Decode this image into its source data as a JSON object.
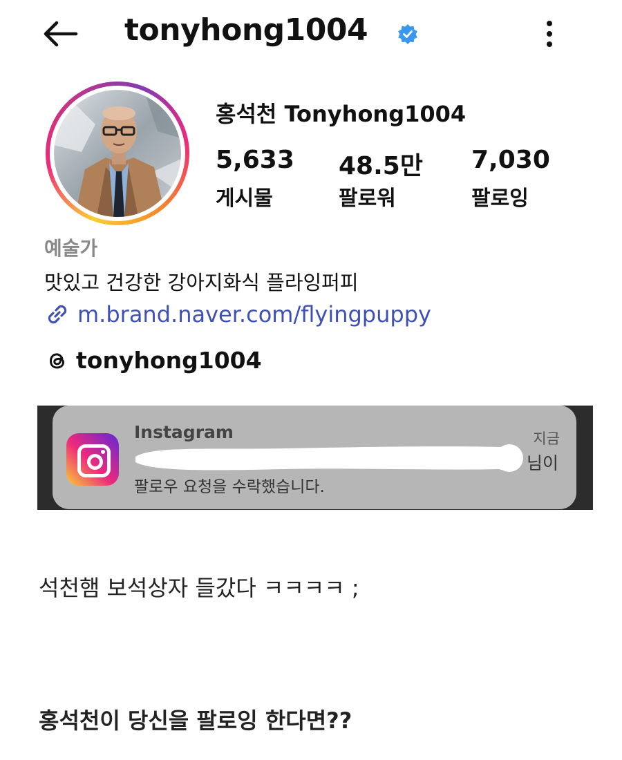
{
  "header": {
    "username": "tonyhong1004",
    "back_icon": "arrow-left-icon",
    "verified_icon": "verified-badge-icon",
    "more_icon": "more-vertical-icon"
  },
  "profile": {
    "display_name": "홍석천 Tonyhong1004",
    "stats": [
      {
        "value": "5,633",
        "label": "게시물"
      },
      {
        "value": "48.5만",
        "label": "팔로워"
      },
      {
        "value": "7,030",
        "label": "팔로잉"
      }
    ],
    "category": "예술가",
    "bio": "맛있고 건강한 강아지화식 플라잉퍼피",
    "link": "m.brand.naver.com/flyingpuppy",
    "threads_handle": "tonyhong1004"
  },
  "notification": {
    "app": "Instagram",
    "time": "지금",
    "name_suffix": "님이",
    "message": "팔로우 요청을 수락했습니다."
  },
  "captions": {
    "line1": "석천햄 보석상자 들갔다 ㅋㅋㅋㅋ ;",
    "line2": "홍석천이 당신을 팔로잉 한다면??"
  },
  "colors": {
    "link": "#3f4fb8",
    "verified": "#3897f0",
    "category": "#888888"
  }
}
